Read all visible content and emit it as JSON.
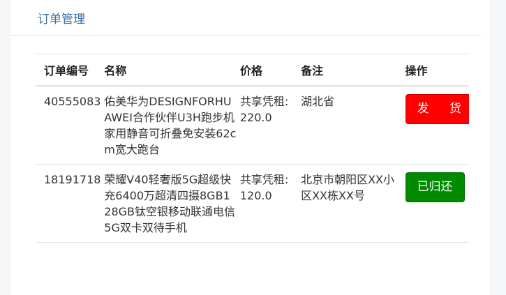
{
  "page": {
    "title": "订单管理"
  },
  "table": {
    "headers": [
      "订单编号",
      "名称",
      "价格",
      "备注",
      "操作"
    ],
    "rows": [
      {
        "order_no": "40555083",
        "name": "佑美华为DESIGNFORHUAWEI合作伙伴U3H跑步机家用静音可折叠免安装62cm宽大跑台",
        "price": "共享凭租:220.0",
        "remark": "湖北省",
        "action": "发 货",
        "action_color": "#ff0000"
      },
      {
        "order_no": "18191718",
        "name": "荣耀V40轻奢版5G超级快充6400万超清四摄8GB128GB钛空银移动联通电信5G双卡双待手机",
        "price": "共享凭租:120.0",
        "remark": "北京市朝阳区XX小区XX栋XX号",
        "action": "已归还",
        "action_color": "#008a00"
      }
    ]
  }
}
